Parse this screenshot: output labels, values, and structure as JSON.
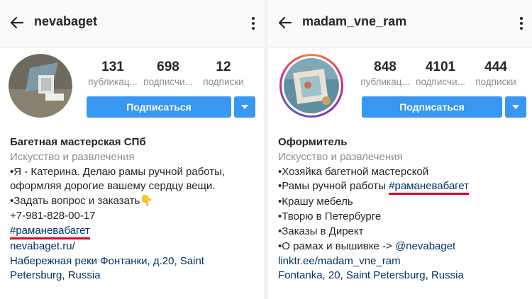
{
  "left": {
    "username": "nevabaget",
    "stats": [
      {
        "value": "131",
        "label": "публикац..."
      },
      {
        "value": "698",
        "label": "подписчи..."
      },
      {
        "value": "12",
        "label": "подписки"
      }
    ],
    "follow_label": "Подписаться",
    "bio": {
      "name": "Багетная мастерская СПб",
      "category": "Искусство и развлечения",
      "lines": [
        "•Я - Катерина. Делаю рамы ручной работы,",
        "оформляя дорогие вашему сердцу вещи.",
        "•Задать вопрос и заказать👇",
        "+7-981-828-00-17"
      ],
      "hashtag": "#раманевабагет",
      "website": "nevabaget.ru/",
      "address_line1": "Набережная реки Фонтанки, д.20, Saint",
      "address_line2": "Petersburg, Russia"
    }
  },
  "right": {
    "username": "madam_vne_ram",
    "stats": [
      {
        "value": "848",
        "label": "публикац..."
      },
      {
        "value": "4101",
        "label": "подписчи..."
      },
      {
        "value": "444",
        "label": "подписки"
      }
    ],
    "follow_label": "Подписаться",
    "bio": {
      "name": "Оформитель",
      "category": "Искусство и развлечения",
      "line1": "•Хозяйка багетной мастерской",
      "line2_prefix": "•Рамы ручной работы ",
      "hashtag": "#раманевабагет",
      "lines": [
        "•Крашу мебель",
        "•Творю в Петербурге",
        "•Заказы в Директ"
      ],
      "mention_prefix": "•О рамах и вышивке -> ",
      "mention": "@nevabaget",
      "website": "linktr.ee/madam_vne_ram",
      "address": "Fontanka, 20, Saint Petersburg, Russia"
    }
  },
  "colors": {
    "accent": "#3897f0",
    "link": "#003569",
    "muted": "#8e8e8e",
    "highlight": "#e0002a"
  }
}
